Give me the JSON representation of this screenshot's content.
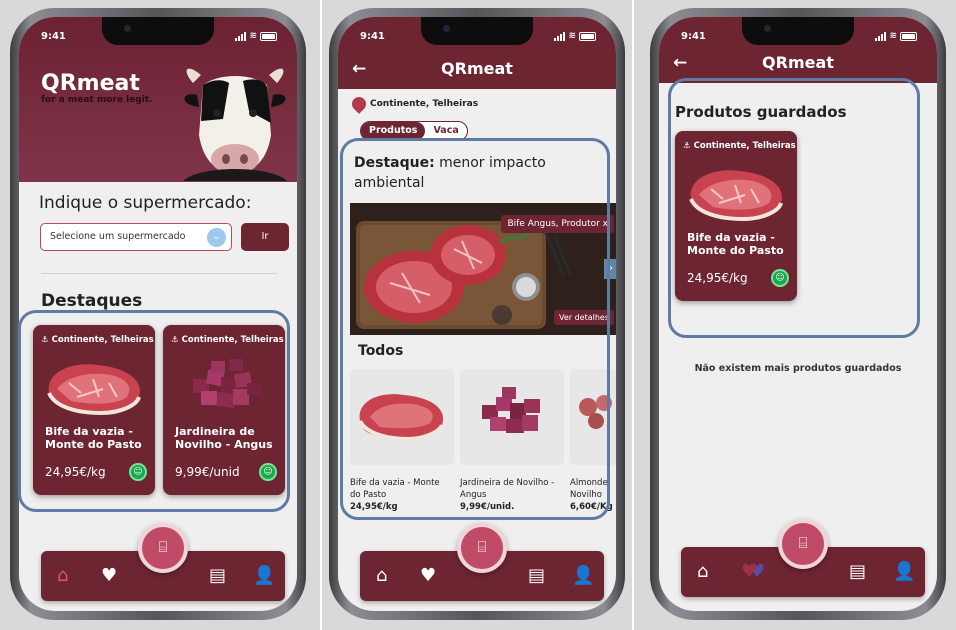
{
  "status": {
    "time": "9:41"
  },
  "screen1": {
    "brand": "QRmeat",
    "tagline": "for a meat more legit.",
    "prompt": "Indique o supermercado:",
    "select_placeholder": "Selecione um supermercado",
    "select_arrow": "⌄",
    "go_button": "Ir",
    "section_title": "Destaques",
    "cards": [
      {
        "store": "Continente, Telheiras",
        "name": "Bife da vazia - Monte do Pasto",
        "price": "24,95€/kg"
      },
      {
        "store": "Continente, Telheiras",
        "name": "Jardineira de Novilho - Angus",
        "price": "9,99€/unid"
      }
    ]
  },
  "screen2": {
    "title": "QRmeat",
    "back": "←",
    "store": "Continente, Telheiras",
    "chips": [
      "Produtos",
      "Vaca"
    ],
    "featured_bold": "Destaque:",
    "featured_rest": " menor impacto ambiental",
    "banner_tag": "Bife Angus, Produtor x",
    "banner_details": "Ver detalhes",
    "banner_next": "›",
    "all_title": "Todos",
    "products": [
      {
        "name": "Bife da vazia - Monte do Pasto",
        "price": "24,95€/kg"
      },
      {
        "name": "Jardineira de Novilho - Angus",
        "price": "9,99€/unid."
      },
      {
        "name": "Almonde Novilho",
        "price": "6,60€/Kg"
      }
    ]
  },
  "screen3": {
    "title": "QRmeat",
    "back": "←",
    "saved_title": "Produtos guardados",
    "card": {
      "store": "Continente, Telheiras",
      "name": "Bife da vazia - Monte do Pasto",
      "price": "24,95€/kg"
    },
    "empty_message": "Não existem mais produtos guardados"
  },
  "nav": {
    "home": "⌂",
    "favorites": "♥",
    "news": "▤",
    "profile": "👤",
    "scan": "⌸"
  },
  "colors": {
    "brand": "#6e2532",
    "scan_button": "#bf4b66",
    "badge_green": "#19a84a",
    "highlight_outline": "#5f7aa3"
  }
}
